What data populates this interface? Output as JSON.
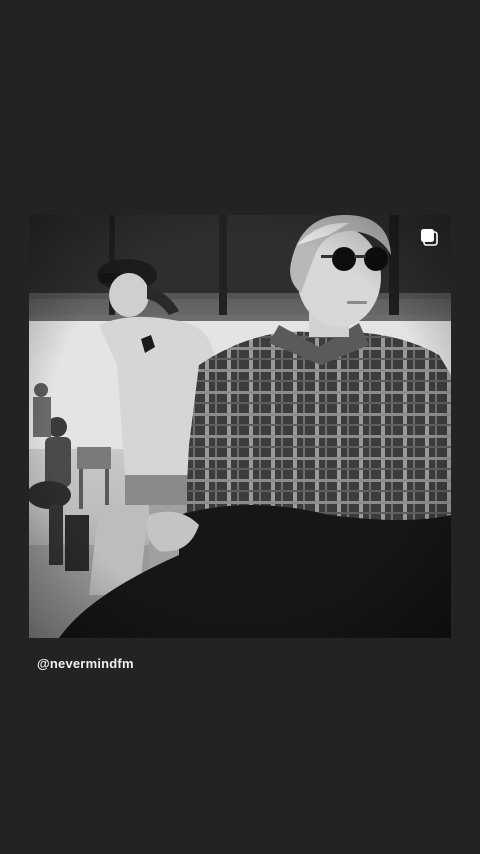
{
  "story": {
    "background_color": "#232323",
    "post": {
      "photo_description_icon": "multiple-photos-icon",
      "tone": "black-and-white"
    },
    "attribution_handle": "@nevermindfm"
  }
}
